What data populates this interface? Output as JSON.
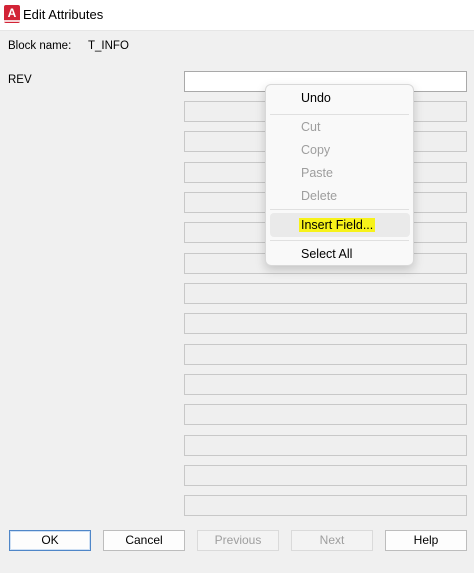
{
  "window": {
    "title": "Edit Attributes",
    "icon": "autocad-app-icon",
    "icon_letter": "A"
  },
  "block": {
    "label": "Block name:",
    "value": "T_INFO"
  },
  "attributes": [
    {
      "label": "REV",
      "value": ""
    }
  ],
  "context_menu": {
    "items": [
      {
        "label": "Undo",
        "enabled": true
      },
      {
        "label": "Cut",
        "enabled": false
      },
      {
        "label": "Copy",
        "enabled": false
      },
      {
        "label": "Paste",
        "enabled": false
      },
      {
        "label": "Delete",
        "enabled": false
      },
      {
        "label": "Insert Field...",
        "enabled": true,
        "highlighted": true
      },
      {
        "label": "Select All",
        "enabled": true
      }
    ],
    "highlight_color": "#f7f21a"
  },
  "buttons": {
    "ok": "OK",
    "cancel": "Cancel",
    "previous": "Previous",
    "next": "Next",
    "help": "Help"
  }
}
